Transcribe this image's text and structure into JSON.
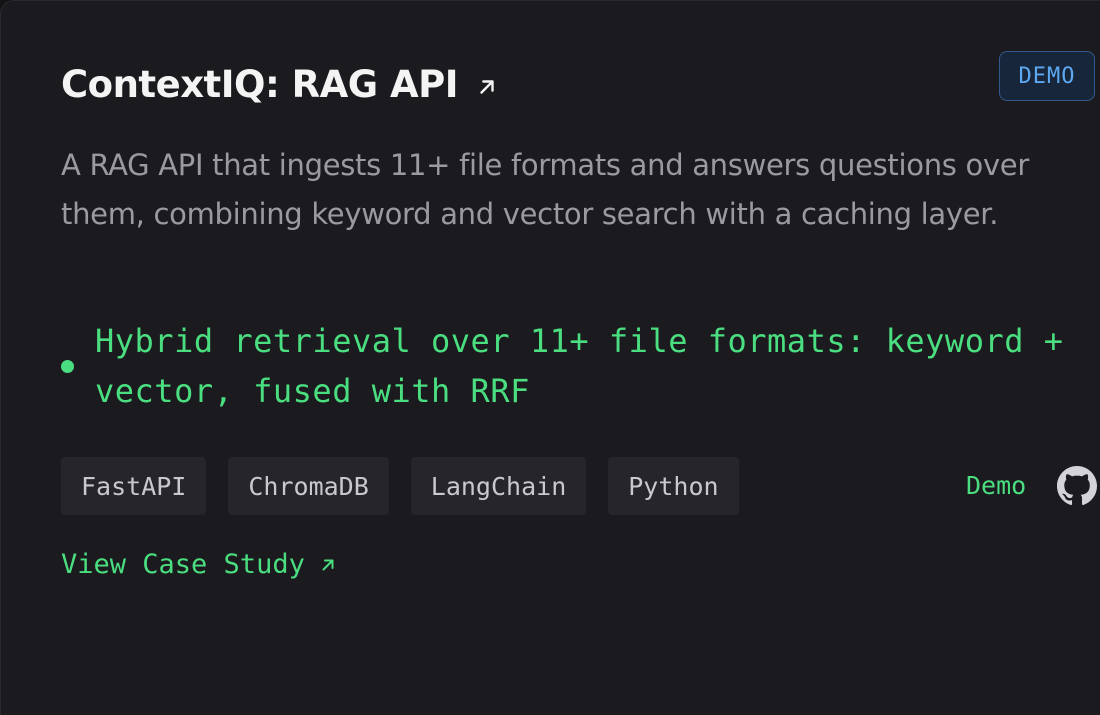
{
  "project": {
    "title": "ContextIQ: RAG API",
    "title_icon": "external-arrow-icon",
    "badge": "DEMO",
    "description": "A RAG API that ingests 11+ file formats and answers questions over them, combining keyword and vector search with a caching layer.",
    "highlights": [
      "Hybrid retrieval over 11+ file formats: keyword + vector, fused with RRF"
    ],
    "tags": [
      "FastAPI",
      "ChromaDB",
      "LangChain",
      "Python"
    ],
    "demo_label": "Demo",
    "github_icon": "github-icon",
    "case_study_label": "View Case Study",
    "case_study_icon": "external-arrow-icon"
  },
  "colors": {
    "background": "#1b1a1e",
    "accent_green": "#4ade80",
    "badge_blue": "#5da8f0",
    "muted_text": "#9b9aa0",
    "tag_bg": "#26252a"
  }
}
